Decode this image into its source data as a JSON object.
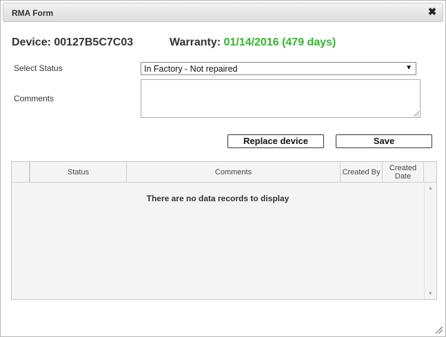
{
  "dialog": {
    "title": "RMA Form",
    "close_glyph": "✖"
  },
  "device": {
    "label": "Device:",
    "id": "00127B5C7C03"
  },
  "warranty": {
    "label": "Warranty:",
    "value": "01/14/2016 (479 days)",
    "color": "#33b52a"
  },
  "form": {
    "status_label": "Select Status",
    "status_value": "In Factory - Not repaired",
    "comments_label": "Comments",
    "comments_value": ""
  },
  "buttons": {
    "replace_label": "Replace device",
    "save_label": "Save"
  },
  "grid": {
    "columns": [
      "",
      "Status",
      "Comments",
      "Created By",
      "Created Date"
    ],
    "rows": [],
    "empty_message": "There are no data records to display"
  }
}
